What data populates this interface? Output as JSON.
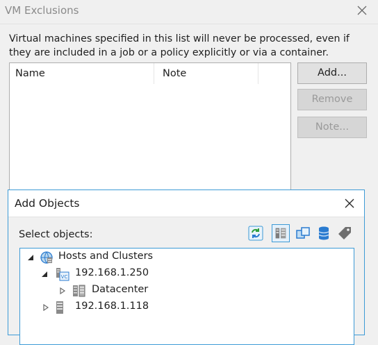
{
  "window": {
    "title": "VM Exclusions",
    "description": "Virtual machines specified in this list will never be processed, even if they are included in a job or a policy explicitly or via a container."
  },
  "list": {
    "columns": [
      "Name",
      "Note"
    ]
  },
  "buttons": {
    "add": "Add...",
    "remove": "Remove",
    "note": "Note..."
  },
  "add_objects": {
    "title": "Add Objects",
    "select_label": "Select objects:",
    "toolbar_icons": [
      "refresh-icon",
      "hosts-and-clusters-view-icon",
      "vms-and-templates-view-icon",
      "datastores-view-icon",
      "tags-view-icon"
    ],
    "tree": {
      "root": "Hosts and Clusters",
      "vcenter": "192.168.1.250",
      "datacenter": "Datacenter",
      "host": "192.168.1.118"
    }
  },
  "colors": {
    "accent": "#3c9ad6",
    "disabled_text": "#9a9a9a"
  }
}
